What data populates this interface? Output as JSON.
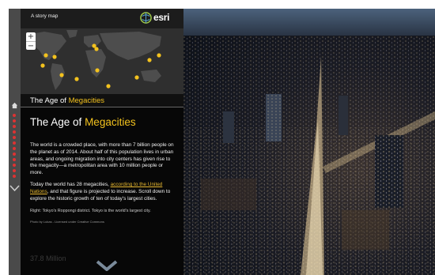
{
  "header": {
    "tagline": "A story map",
    "logo_text": "esri"
  },
  "map": {
    "zoom_in": "+",
    "zoom_out": "−",
    "marker_color": "#f3c21e"
  },
  "section": {
    "title_prefix": "The Age of ",
    "title_highlight": "Megacities"
  },
  "article": {
    "heading_prefix": "The Age of ",
    "heading_highlight": "Megacities",
    "paragraph1": "The world is a crowded place, with more than 7 billion people on the planet as of 2014. About half of this population lives in urban areas, and ongoing migration into city centers has given rise to the megacity—a metropolitan area with 10 million people or more.",
    "paragraph2_before": "Today the world has 28 megacities, ",
    "paragraph2_link": "according to the United Nations",
    "paragraph2_after": ", and that figure is projected to increase. Scroll down to explore the historic growth of ten of today's largest cities.",
    "caption": "Right: Tokyo's Roppongi district. Tokyo is the world's largest city.",
    "credit": "Photo by Lukas - Licensed under Creative Commons"
  },
  "footer": {
    "stat": "37.8 Million"
  },
  "colors": {
    "accent": "#f3c21e",
    "nav_dot": "#dd3333"
  }
}
